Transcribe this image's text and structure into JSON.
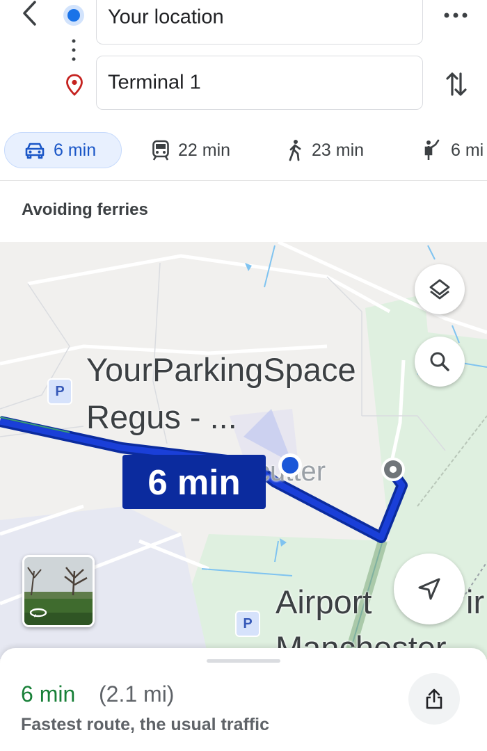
{
  "header": {
    "origin_value": "Your location",
    "destination_value": "Terminal 1"
  },
  "modes": [
    {
      "icon": "car-icon",
      "label": "6 min",
      "active": true
    },
    {
      "icon": "train-icon",
      "label": "22 min",
      "active": false
    },
    {
      "icon": "walk-icon",
      "label": "23 min",
      "active": false
    },
    {
      "icon": "ride-hail-icon",
      "label": "6 mi",
      "active": false
    }
  ],
  "notice": "Avoiding ferries",
  "map": {
    "labels": {
      "parking_name": "YourParkingSpace",
      "regus": "Regus - ...",
      "cutter": "cutter",
      "airport": "Airport",
      "manchester": "Manchester",
      "partial_right": "ir"
    },
    "parking_badge": "P",
    "eta_label": "6 min",
    "route_color": "#1a3fd8",
    "route_dark": "#0b2b9e"
  },
  "summary": {
    "time": "6 min",
    "distance": "(2.1 mi)",
    "description": "Fastest route, the usual traffic"
  },
  "colors": {
    "accent_blue": "#1a56c7",
    "green_time": "#188038"
  }
}
